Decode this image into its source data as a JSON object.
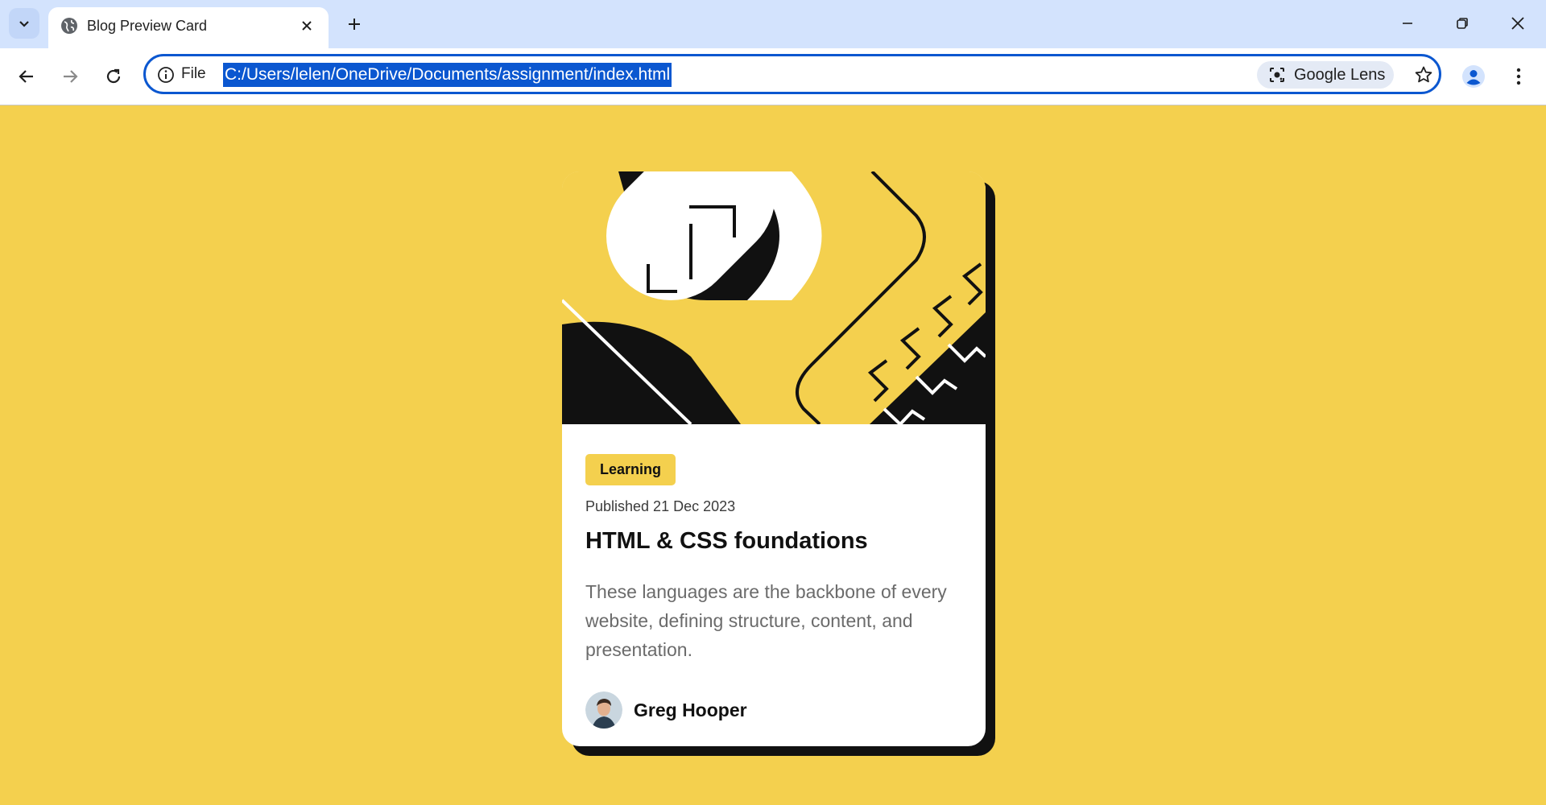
{
  "browser": {
    "tab_title": "Blog Preview Card",
    "scheme_label": "File",
    "url": "C:/Users/lelen/OneDrive/Documents/assignment/index.html",
    "lens_label": "Google Lens",
    "accent_color": "#0b57d0",
    "tabstrip_color": "#d3e3fd"
  },
  "page": {
    "background_color": "#f4d04e",
    "card": {
      "tag": "Learning",
      "published": "Published 21 Dec 2023",
      "title": "HTML & CSS foundations",
      "excerpt": "These languages are the backbone of every website, defining structure, content, and presentation.",
      "author_name": "Greg Hooper",
      "shadow_color": "#111111"
    }
  }
}
